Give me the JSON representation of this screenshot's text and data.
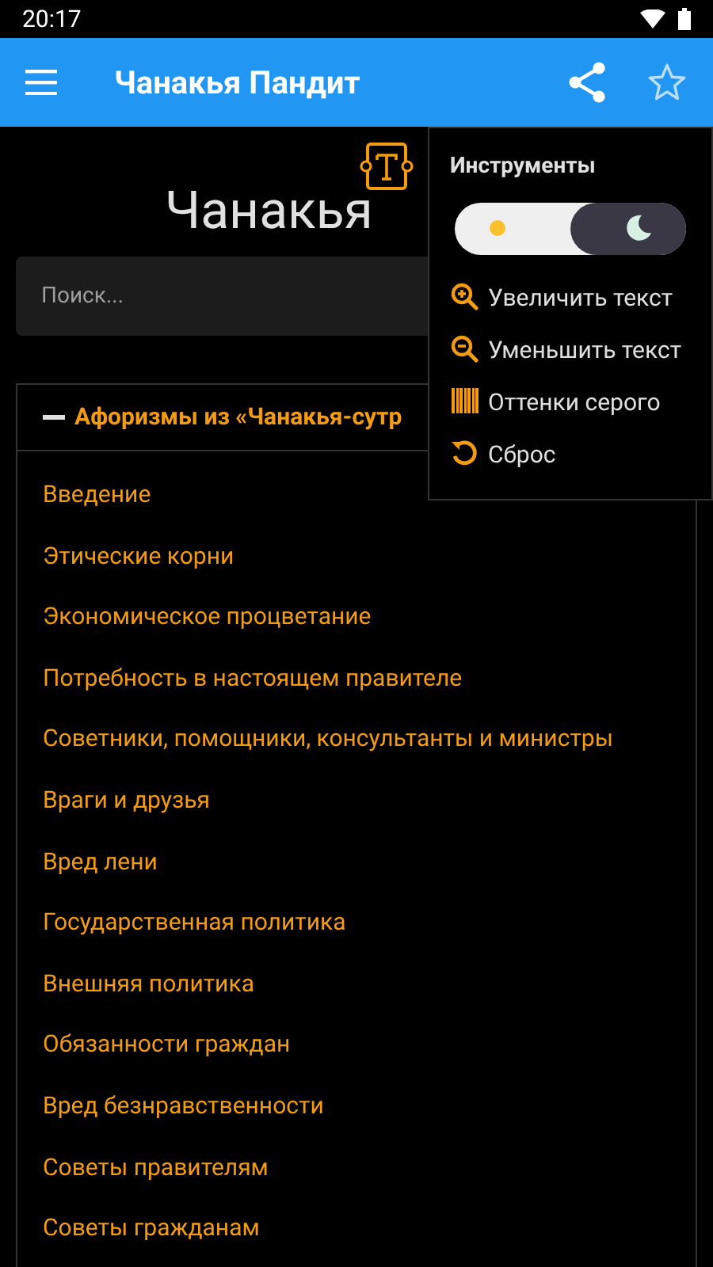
{
  "status_bar": {
    "time": "20:17"
  },
  "app_bar": {
    "title": "Чанакья Пандит"
  },
  "page": {
    "heading": "Чанакья",
    "search": {
      "placeholder": "Поиск..."
    }
  },
  "section": {
    "title": "Афоризмы из «Чанакья-сутр",
    "expanded": true,
    "items": [
      "Введение",
      "Этические корни",
      "Экономическое процветание",
      "Потребность в настоящем правителе",
      "Советники, помощники, консультанты и министры",
      "Враги и друзья",
      "Вред лени",
      "Государственная политика",
      "Внешняя политика",
      "Обязанности граждан",
      "Вред безнравственности",
      "Советы правителям",
      "Советы гражданам"
    ]
  },
  "tools_menu": {
    "title": "Инструменты",
    "dark_mode": true,
    "items": [
      {
        "kind": "zoom-in",
        "label": "Увеличить текст"
      },
      {
        "kind": "zoom-out",
        "label": "Уменьшить текст"
      },
      {
        "kind": "grayscale",
        "label": "Оттенки серого"
      },
      {
        "kind": "reset",
        "label": "Сброс"
      }
    ]
  }
}
